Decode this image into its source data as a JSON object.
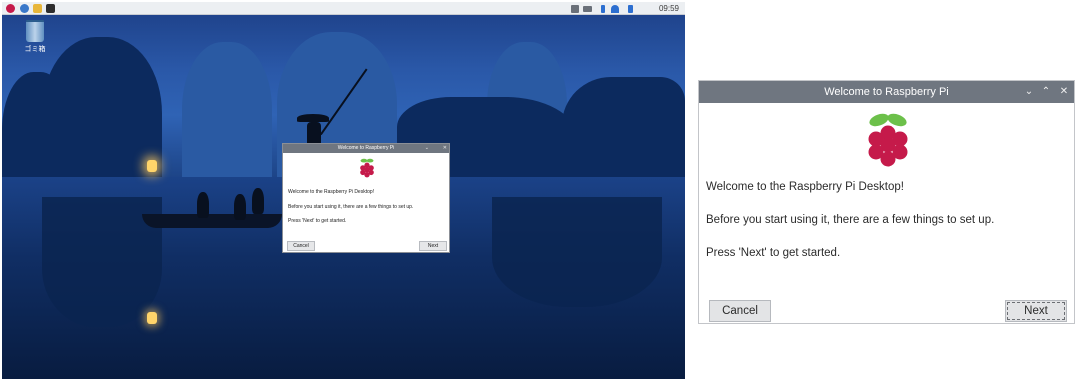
{
  "taskbar": {
    "launchers": [
      "raspberry-menu-icon",
      "web-browser-icon",
      "file-manager-icon",
      "terminal-icon"
    ],
    "tray_icons": [
      "network-icon",
      "battery-icon",
      "bluetooth-icon",
      "wifi-icon",
      "volume-icon"
    ],
    "clock": "09:59"
  },
  "desktop": {
    "trash_label": "ゴミ箱"
  },
  "dialog": {
    "title": "Welcome to Raspberry Pi",
    "controls": {
      "minimize": "⌄",
      "maximize": "⌃",
      "close": "✕"
    },
    "line1": "Welcome to the Raspberry Pi Desktop!",
    "line2": "Before you start using it, there are a few things to set up.",
    "line3": "Press 'Next' to get started.",
    "cancel_label": "Cancel",
    "next_label": "Next"
  },
  "colors": {
    "raspberry": "#c51a4a",
    "leaf": "#6cc04a",
    "titlebar": "#6f7680"
  }
}
